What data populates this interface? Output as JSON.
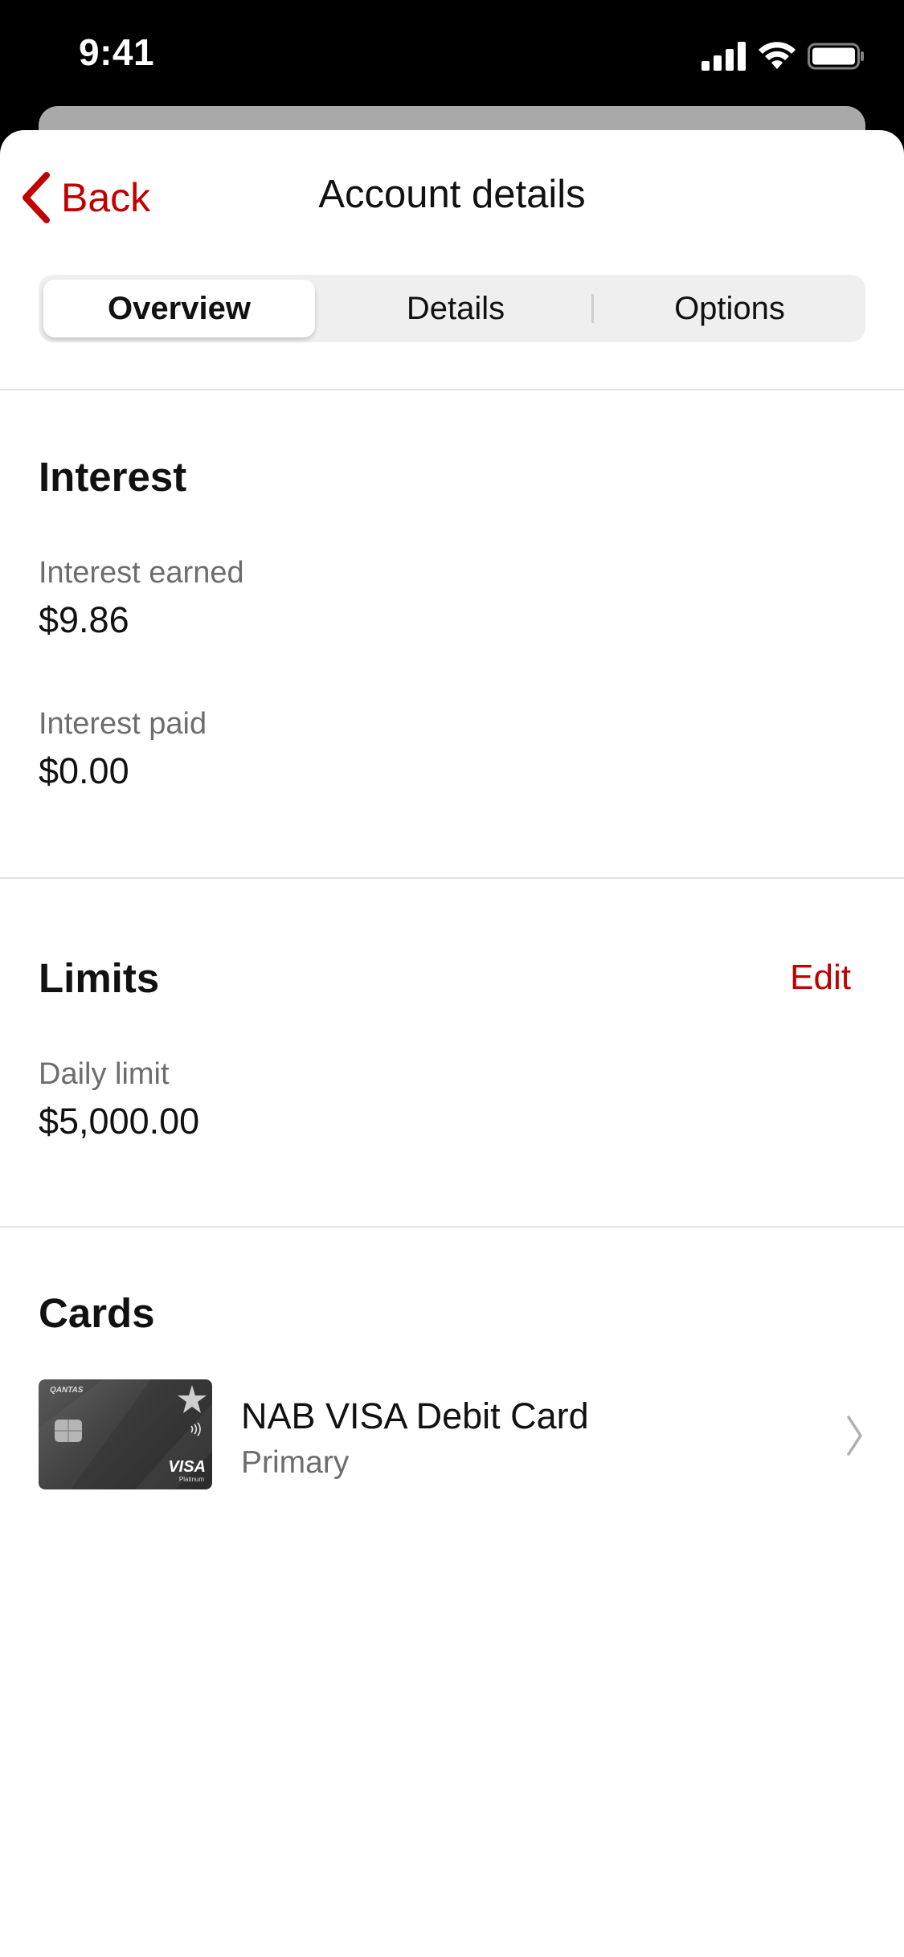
{
  "status": {
    "time": "9:41"
  },
  "nav": {
    "back_label": "Back",
    "title": "Account details"
  },
  "tabs": [
    {
      "label": "Overview",
      "active": true
    },
    {
      "label": "Details",
      "active": false
    },
    {
      "label": "Options",
      "active": false
    }
  ],
  "interest": {
    "title": "Interest",
    "earned_label": "Interest earned",
    "earned_value": "$9.86",
    "paid_label": "Interest paid",
    "paid_value": "$0.00"
  },
  "limits": {
    "title": "Limits",
    "edit_label": "Edit",
    "daily_label": "Daily limit",
    "daily_value": "$5,000.00"
  },
  "cards": {
    "title": "Cards",
    "items": [
      {
        "name": "NAB VISA Debit Card",
        "subtitle": "Primary",
        "brand_text": "VISA",
        "tier_text": "Platinum",
        "partner_text": "QANTAS"
      }
    ]
  },
  "colors": {
    "accent": "#c20000",
    "secondary_text": "#6d6d6d",
    "divider": "#e2e2e2"
  },
  "icons": [
    "signal-icon",
    "wifi-icon",
    "battery-icon",
    "back-chevron-icon",
    "chevron-right-icon",
    "contactless-icon",
    "nab-star-icon"
  ]
}
